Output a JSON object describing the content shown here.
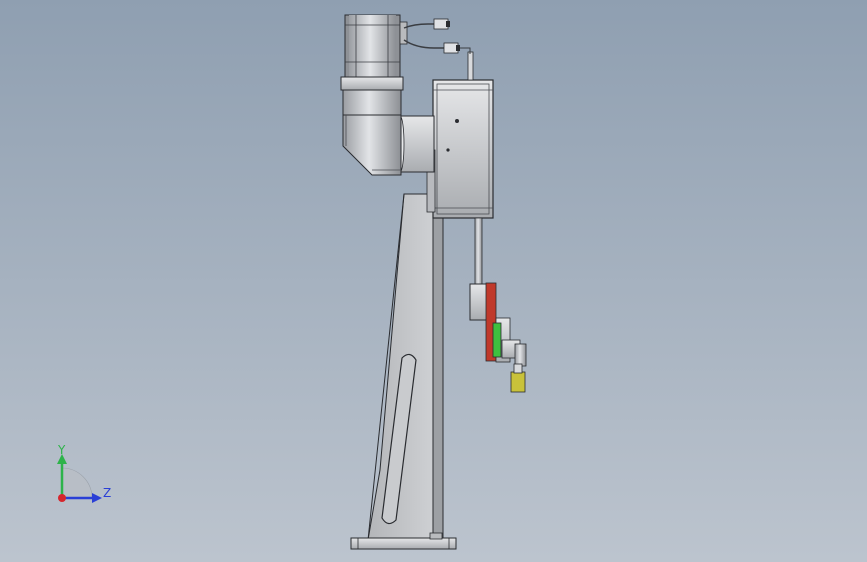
{
  "viewport": {
    "background_top": "#8f9fb1",
    "background_bottom": "#bcc4ce"
  },
  "model": {
    "metal_color": "#c7c9cc",
    "edge_color": "#2a2c30",
    "red_part_color": "#c0392b",
    "green_part_color": "#3fbf3f",
    "yellow_part_color": "#c9c23a"
  },
  "triad": {
    "y_label": "Y",
    "z_label": "Z",
    "y_color": "#2db34a",
    "z_color": "#2a3fd6",
    "x_color": "#d6262d"
  }
}
